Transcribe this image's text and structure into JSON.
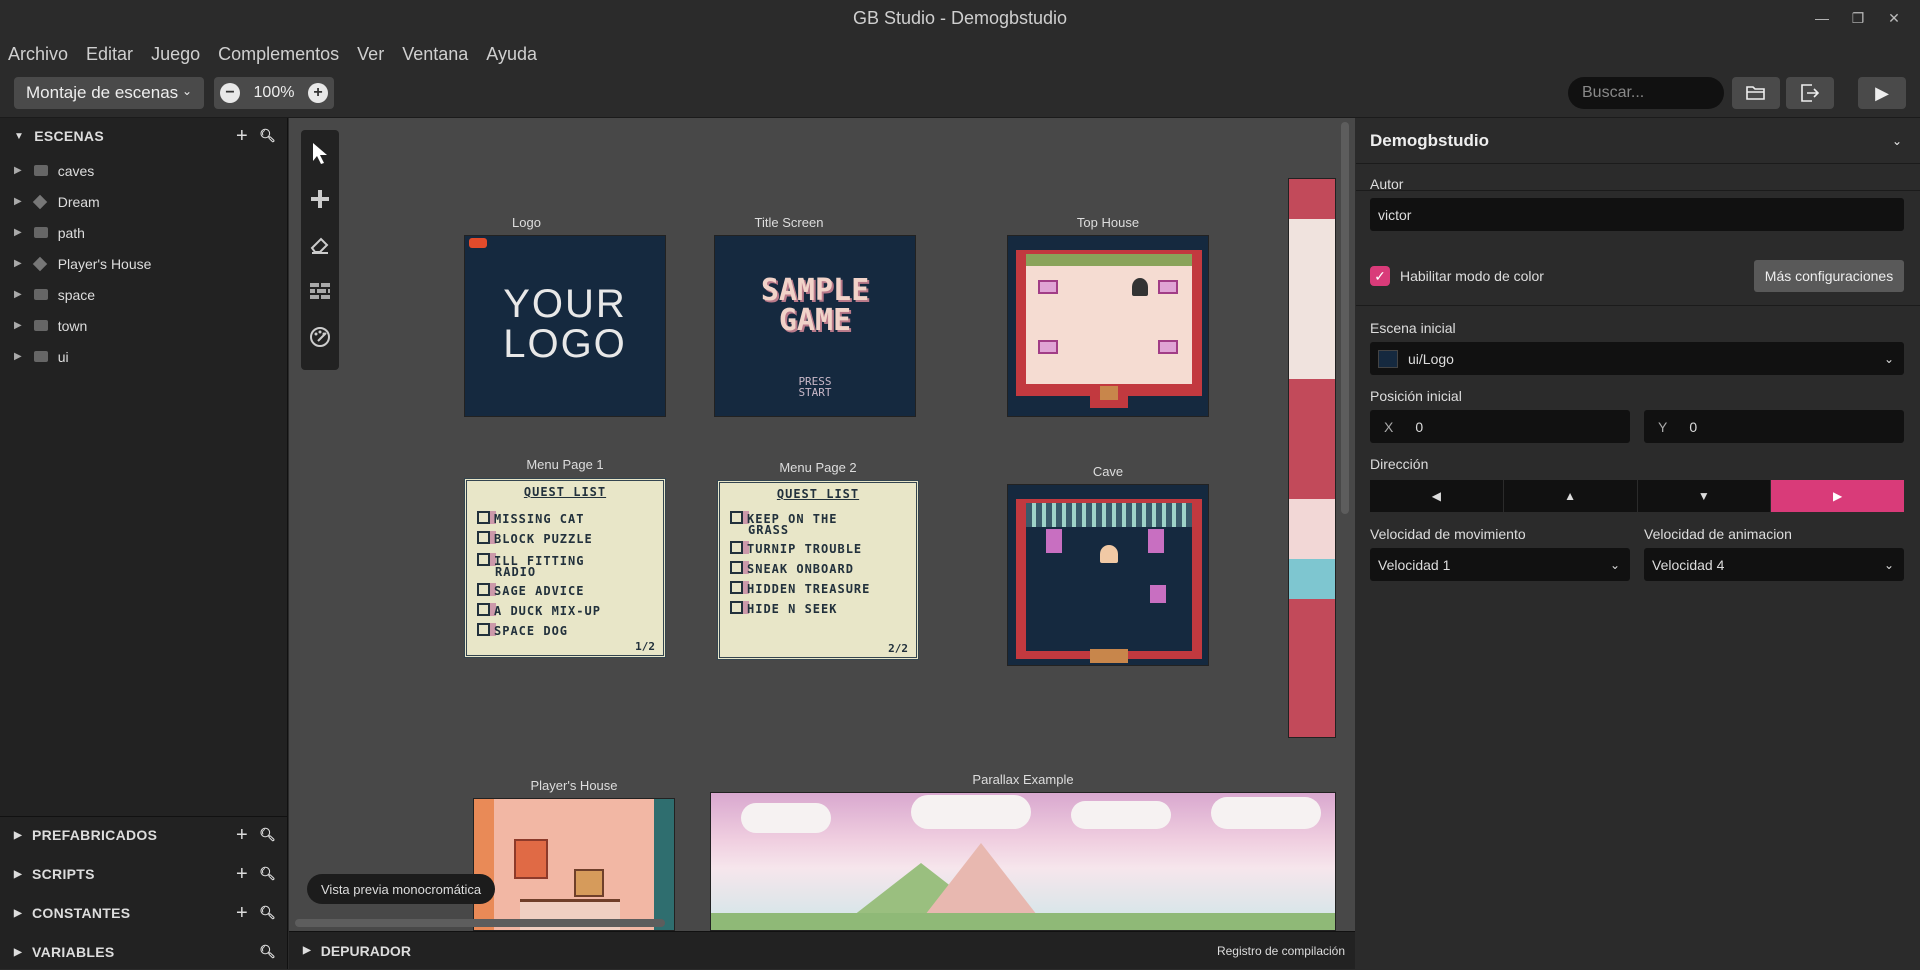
{
  "window": {
    "title": "GB Studio - Demogbstudio"
  },
  "menu": [
    "Archivo",
    "Editar",
    "Juego",
    "Complementos",
    "Ver",
    "Ventana",
    "Ayuda"
  ],
  "toolbar": {
    "view_mode": "Montaje de escenas",
    "zoom": "100%",
    "search_placeholder": "Buscar..."
  },
  "sidebar": {
    "scenes_title": "ESCENAS",
    "scenes": [
      {
        "label": "caves",
        "icon": "folder-icon"
      },
      {
        "label": "Dream",
        "icon": "scene-icon"
      },
      {
        "label": "path",
        "icon": "folder-icon"
      },
      {
        "label": "Player's House",
        "icon": "scene-icon"
      },
      {
        "label": "space",
        "icon": "folder-icon"
      },
      {
        "label": "town",
        "icon": "folder-icon"
      },
      {
        "label": "ui",
        "icon": "folder-icon"
      }
    ],
    "prefabs": "PREFABRICADOS",
    "scripts": "SCRIPTS",
    "constants": "CONSTANTES",
    "variables": "VARIABLES"
  },
  "canvas": {
    "scenes": {
      "logo": {
        "name": "Logo",
        "line1": "YOUR",
        "line2": "LOGO"
      },
      "title": {
        "name": "Title Screen",
        "line1": "SAMPLE",
        "line2": "GAME",
        "press": "PRESS",
        "start": "START"
      },
      "top_house": {
        "name": "Top House"
      },
      "menu1": {
        "name": "Menu Page 1",
        "heading": "QUEST LIST",
        "items": [
          "MISSING CAT",
          "BLOCK PUZZLE",
          "ILL FITTING",
          "RADIO",
          "SAGE ADVICE",
          "A DUCK MIX-UP",
          "SPACE DOG"
        ],
        "page": "1/2"
      },
      "menu2": {
        "name": "Menu Page 2",
        "heading": "QUEST LIST",
        "items": [
          "KEEP ON THE",
          "GRASS",
          "TURNIP TROUBLE",
          "SNEAK ONBOARD",
          "HIDDEN TREASURE",
          "HIDE N SEEK"
        ],
        "page": "2/2"
      },
      "cave": {
        "name": "Cave"
      },
      "players_house": {
        "name": "Player's House"
      },
      "parallax": {
        "name": "Parallax Example"
      }
    },
    "tooltip": "Vista previa monocromática"
  },
  "debugger": {
    "label": "DEPURADOR",
    "build_log": "Registro de compilación"
  },
  "project": {
    "name": "Demogbstudio",
    "author_label": "Autor",
    "author": "victor",
    "color_mode_label": "Habilitar modo de color",
    "color_mode": true,
    "more_settings": "Más configuraciones",
    "start_scene_label": "Escena inicial",
    "start_scene": "ui/Logo",
    "start_pos_label": "Posición inicial",
    "x_label": "X",
    "x": "0",
    "y_label": "Y",
    "y": "0",
    "direction_label": "Dirección",
    "direction": "right",
    "move_speed_label": "Velocidad de movimiento",
    "move_speed": "Velocidad 1",
    "anim_speed_label": "Velocidad de animacion",
    "anim_speed": "Velocidad 4"
  },
  "colors": {
    "accent": "#d93b79",
    "background": "#2b2b2b",
    "canvas": "#484848"
  }
}
